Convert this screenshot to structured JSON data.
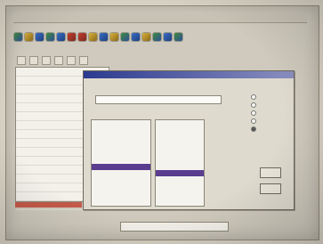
{
  "window": {
    "title": ""
  },
  "toolbar": {
    "icons": [
      "tool-icon",
      "tool-icon",
      "tool-icon",
      "tool-icon",
      "tool-icon",
      "tool-icon",
      "tool-icon",
      "tool-icon",
      "tool-icon",
      "tool-icon",
      "tool-icon",
      "tool-icon",
      "tool-icon",
      "tool-icon",
      "tool-icon",
      "tool-icon"
    ]
  },
  "tabs": [
    "",
    "",
    "",
    "",
    "",
    ""
  ],
  "grid": {
    "rows": 16
  },
  "dialog": {
    "title": "",
    "name_label": "",
    "name_value": "",
    "list_a_label": "",
    "list_b_label": "",
    "list_a_items": [
      "",
      "",
      "",
      "",
      "",
      "",
      "",
      "",
      "",
      "",
      "",
      "",
      ""
    ],
    "list_a_selected": 7,
    "list_b_items": [
      "",
      "",
      "",
      "",
      "",
      "",
      "",
      "",
      "",
      "",
      "",
      "",
      ""
    ],
    "list_b_selected": 8,
    "options_label": "",
    "options": [
      "",
      "",
      "",
      "",
      ""
    ],
    "options_selected": 4,
    "ok_label": "",
    "cancel_label": ""
  },
  "status": {
    "line1": "",
    "line2": "",
    "line3": "",
    "path": ""
  },
  "corner": ""
}
